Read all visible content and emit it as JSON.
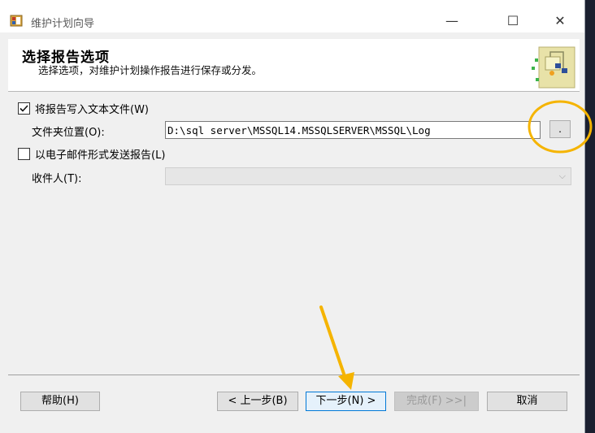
{
  "window": {
    "title": "维护计划向导",
    "minimize_glyph": "—",
    "maximize_glyph": "☐",
    "close_glyph": "✕"
  },
  "header": {
    "title": "选择报告选项",
    "subtitle": "选择选项，对维护计划操作报告进行保存或分发。"
  },
  "options": {
    "write_to_file": {
      "label": "将报告写入文本文件(W)",
      "checked": true
    },
    "folder_location": {
      "label": "文件夹位置(O):",
      "value": "D:\\sql server\\MSSQL14.MSSQLSERVER\\MSSQL\\Log"
    },
    "browse_label": ".",
    "email_report": {
      "label": "以电子邮件形式发送报告(L)",
      "checked": false
    },
    "recipient": {
      "label": "收件人(T):",
      "value": ""
    }
  },
  "buttons": {
    "help": "帮助(H)",
    "back": "< 上一步(B)",
    "next": "下一步(N) >",
    "finish": "完成(F) >>|",
    "cancel": "取消"
  },
  "colors": {
    "annotation": "#f5b400",
    "accent": "#0078d7"
  }
}
